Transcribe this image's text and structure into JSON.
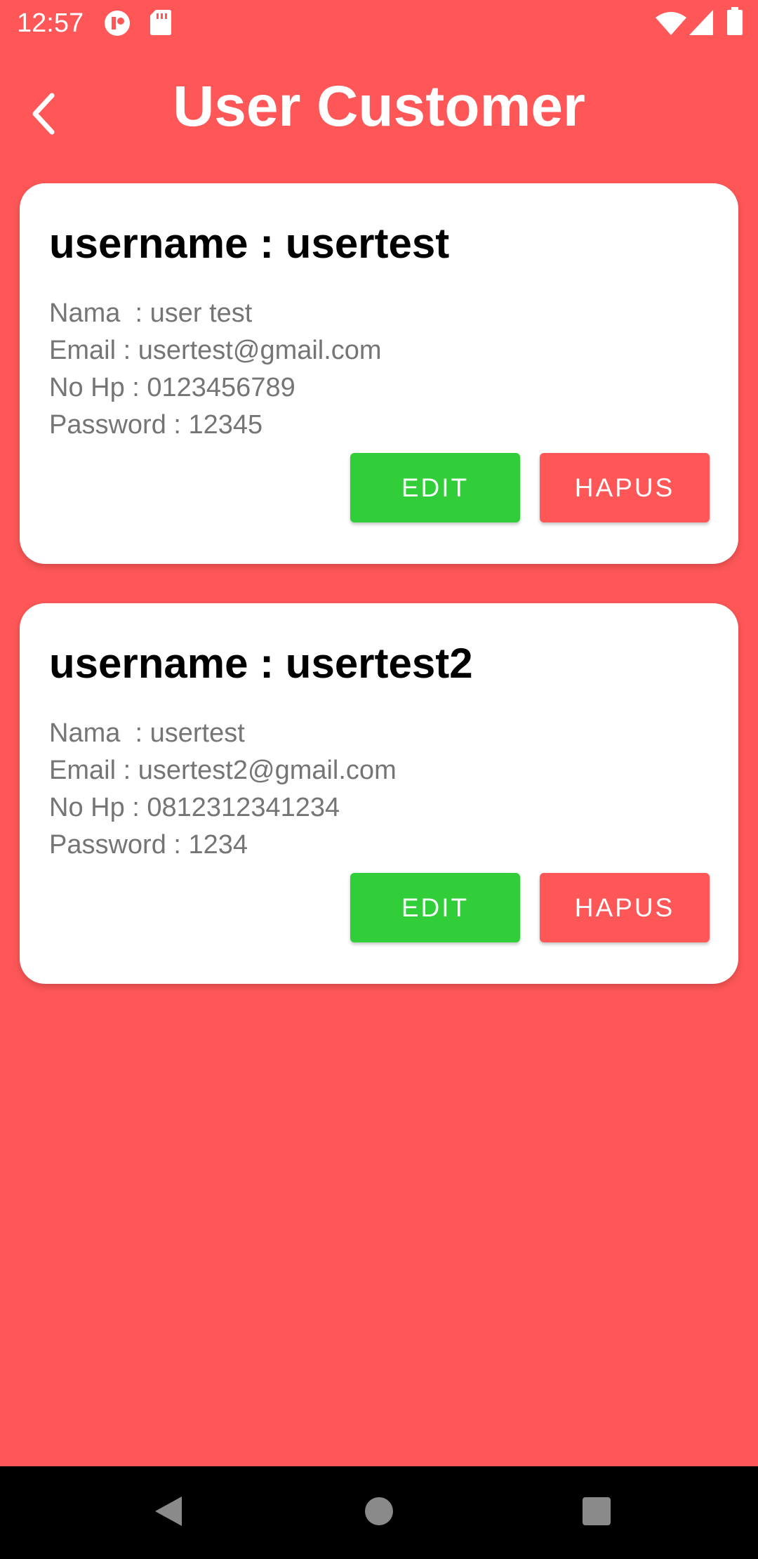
{
  "status_bar": {
    "time": "12:57",
    "icons": [
      "notification-app-icon",
      "sd-card-icon",
      "wifi-icon",
      "signal-icon",
      "battery-icon"
    ]
  },
  "app_bar": {
    "title": "User Customer",
    "back_icon": "chevron-left-icon"
  },
  "users": [
    {
      "username_line": "username : usertest",
      "nama_line": "Nama  : user test",
      "email_line": "Email : usertest@gmail.com",
      "nohp_line": "No Hp : 0123456789",
      "password_line": "Password : 12345",
      "edit_label": "EDIT",
      "hapus_label": "HAPUS"
    },
    {
      "username_line": "username : usertest2",
      "nama_line": "Nama  : usertest",
      "email_line": "Email : usertest2@gmail.com",
      "nohp_line": "No Hp : 0812312341234",
      "password_line": "Password : 1234",
      "edit_label": "EDIT",
      "hapus_label": "HAPUS"
    }
  ],
  "nav_bar": {
    "icons": [
      "back-triangle-icon",
      "home-circle-icon",
      "recents-square-icon"
    ]
  },
  "colors": {
    "background": "#FF5757",
    "edit_button": "#31CE3A",
    "hapus_button": "#FF5757",
    "card": "#FFFFFF",
    "secondary_text": "#757575",
    "nav_bar": "#000000"
  }
}
